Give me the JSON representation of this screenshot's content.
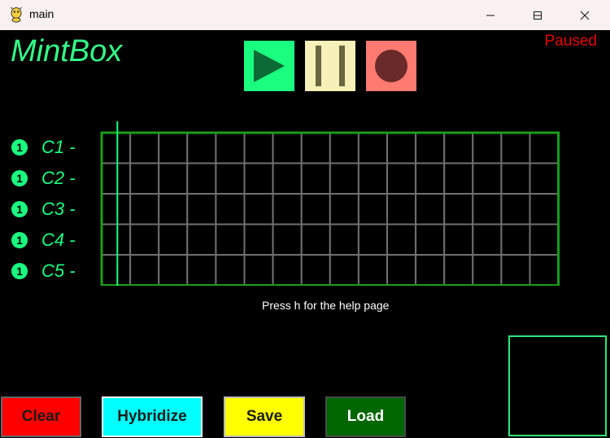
{
  "window": {
    "title": "main",
    "icon": "python-icon",
    "controls": [
      "minimize-icon",
      "maximize-icon",
      "close-icon"
    ]
  },
  "app": {
    "logo": "MintBox",
    "status": "Paused",
    "status_color": "#e60000"
  },
  "transport": {
    "play_icon": "play-icon",
    "pause_icon": "pause-icon",
    "record_icon": "record-icon"
  },
  "rows": [
    {
      "number": "1",
      "note": "C1 -"
    },
    {
      "number": "1",
      "note": "C2 -"
    },
    {
      "number": "1",
      "note": "C3 -"
    },
    {
      "number": "1",
      "note": "C4 -"
    },
    {
      "number": "1",
      "note": "C5 -"
    }
  ],
  "grid": {
    "rows": 5,
    "columns": 16,
    "playhead_step": 0
  },
  "help_text": "Press h for the help page",
  "buttons": {
    "clear": "Clear",
    "hybridize": "Hybridize",
    "save": "Save",
    "load": "Load"
  },
  "colors": {
    "mint": "#1aff80",
    "grid_border": "#1a9e1a",
    "grid_lines": "#707070"
  }
}
